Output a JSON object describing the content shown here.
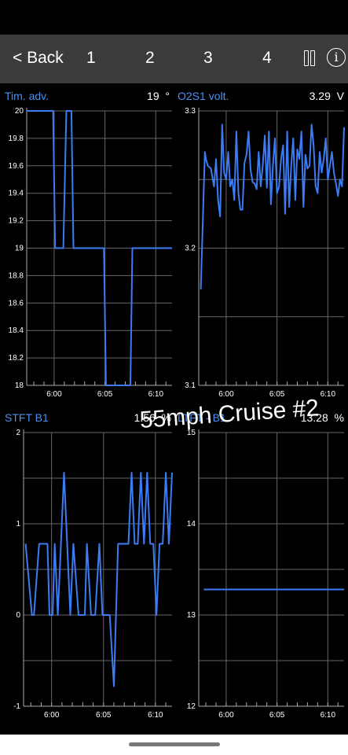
{
  "toolbar": {
    "back_label": "< Back",
    "pages": [
      "1",
      "2",
      "3",
      "4"
    ],
    "pause_icon": "pause-icon",
    "info_icon": "info-icon",
    "info_glyph": "i",
    "background": "#3b3b3b"
  },
  "overlay": {
    "caption": "55mph Cruise #2"
  },
  "colors": {
    "series": "#3d7bf2",
    "title": "#4e8ff0",
    "grid": "#666666"
  },
  "chart_data": [
    {
      "type": "line",
      "title": "Tim. adv.",
      "current_value": "19",
      "unit": "°",
      "ylim": [
        18,
        20
      ],
      "yticks": [
        "20",
        "19.8",
        "19.6",
        "19.4",
        "19.2",
        "19",
        "18.8",
        "18.6",
        "18.4",
        "18.2",
        "18"
      ],
      "ytick_values": [
        20,
        19.8,
        19.6,
        19.4,
        19.2,
        19,
        18.8,
        18.6,
        18.4,
        18.2,
        18
      ],
      "xticks": [
        "6:00",
        "6:05",
        "6:10"
      ],
      "xtick_values": [
        6.0,
        11.0,
        16.0
      ],
      "xlim": [
        3.3,
        17.6
      ],
      "x": [
        3.3,
        5.9,
        6.1,
        6.4,
        6.9,
        7.2,
        7.7,
        7.9,
        8.4,
        9.3,
        10.9,
        11.1,
        12.1,
        13.5,
        13.7,
        15.0,
        17.6
      ],
      "values": [
        20,
        20,
        19,
        19,
        19,
        20,
        20,
        19,
        19,
        19,
        19,
        18,
        18,
        18,
        19,
        19,
        19
      ]
    },
    {
      "type": "line",
      "title": "O2S1 volt.",
      "current_value": "3.29",
      "unit": "V",
      "ylim": [
        3.1,
        3.3
      ],
      "yticks": [
        "3.3",
        "3.2",
        "3.1"
      ],
      "ytick_values": [
        3.3,
        3.2,
        3.1
      ],
      "xticks": [
        "6:00",
        "6:05",
        "6:10"
      ],
      "xtick_values": [
        6.0,
        11.0,
        16.0
      ],
      "xlim": [
        3.3,
        17.6
      ],
      "x": [
        3.5,
        3.7,
        3.9,
        4.0,
        4.2,
        4.5,
        4.8,
        5.0,
        5.2,
        5.4,
        5.6,
        5.8,
        6.0,
        6.2,
        6.4,
        6.6,
        6.8,
        7.0,
        7.2,
        7.4,
        7.6,
        7.8,
        8.0,
        8.2,
        8.4,
        8.6,
        8.8,
        9.0,
        9.2,
        9.4,
        9.6,
        9.8,
        10.0,
        10.2,
        10.4,
        10.6,
        10.8,
        11.0,
        11.2,
        11.4,
        11.6,
        11.8,
        12.0,
        12.2,
        12.4,
        12.6,
        12.8,
        13.0,
        13.2,
        13.4,
        13.6,
        13.8,
        14.0,
        14.2,
        14.4,
        14.6,
        14.8,
        15.0,
        15.2,
        15.4,
        15.6,
        15.8,
        16.0,
        16.2,
        16.4,
        16.6,
        16.8,
        17.0,
        17.2,
        17.4,
        17.6
      ],
      "values": [
        3.17,
        3.22,
        3.27,
        3.265,
        3.26,
        3.258,
        3.245,
        3.265,
        3.235,
        3.223,
        3.29,
        3.255,
        3.25,
        3.27,
        3.245,
        3.25,
        3.235,
        3.285,
        3.24,
        3.228,
        3.228,
        3.262,
        3.268,
        3.285,
        3.257,
        3.248,
        3.247,
        3.243,
        3.27,
        3.245,
        3.26,
        3.282,
        3.244,
        3.285,
        3.232,
        3.26,
        3.28,
        3.24,
        3.245,
        3.265,
        3.275,
        3.225,
        3.285,
        3.23,
        3.26,
        3.28,
        3.235,
        3.272,
        3.265,
        3.285,
        3.23,
        3.268,
        3.258,
        3.26,
        3.29,
        3.275,
        3.245,
        3.24,
        3.27,
        3.255,
        3.265,
        3.28,
        3.25,
        3.26,
        3.27,
        3.255,
        3.247,
        3.238,
        3.25,
        3.245,
        3.288
      ]
    },
    {
      "type": "line",
      "title": "STFT B1",
      "current_value": "1.56",
      "unit": "%",
      "ylim": [
        -1,
        2
      ],
      "yticks": [
        "2",
        "1",
        "0",
        "-1"
      ],
      "ytick_values": [
        2,
        1,
        0,
        -1
      ],
      "xticks": [
        "6:00",
        "6:05",
        "6:10"
      ],
      "xtick_values": [
        6.0,
        11.0,
        16.0
      ],
      "xlim": [
        3.3,
        17.6
      ],
      "x": [
        3.5,
        4.1,
        4.3,
        4.8,
        5.3,
        5.6,
        5.8,
        6.1,
        6.3,
        6.6,
        6.9,
        7.2,
        7.5,
        7.8,
        8.1,
        8.6,
        8.9,
        9.2,
        9.4,
        9.8,
        10.2,
        10.6,
        10.9,
        11.3,
        11.6,
        12.0,
        12.4,
        12.8,
        13.1,
        13.4,
        13.7,
        14.0,
        14.3,
        14.6,
        14.9,
        15.2,
        15.5,
        15.8,
        16.1,
        16.4,
        16.7,
        17.0,
        17.3,
        17.6
      ],
      "values": [
        0.78,
        0,
        0,
        0.78,
        0.78,
        0.78,
        0,
        0,
        0.78,
        0,
        0.78,
        1.56,
        0.78,
        0,
        0.78,
        0,
        0,
        0,
        0.78,
        0,
        0,
        0.78,
        0,
        0,
        0,
        -0.78,
        0.78,
        0.78,
        0.78,
        0.78,
        1.56,
        0.78,
        0.78,
        1.56,
        0.78,
        1.56,
        0.78,
        0.78,
        0,
        0.78,
        0.78,
        1.56,
        0.78,
        1.56
      ]
    },
    {
      "type": "line",
      "title": "LTFT - B1",
      "current_value": "13.28",
      "unit": "%",
      "ylim": [
        12,
        15
      ],
      "yticks": [
        "15",
        "14",
        "13",
        "12"
      ],
      "ytick_values": [
        15,
        14,
        13,
        12
      ],
      "xticks": [
        "6:00",
        "6:05",
        "6:10"
      ],
      "xtick_values": [
        6.0,
        11.0,
        16.0
      ],
      "xlim": [
        3.3,
        17.6
      ],
      "x": [
        3.8,
        17.6
      ],
      "values": [
        13.28,
        13.28
      ]
    }
  ]
}
